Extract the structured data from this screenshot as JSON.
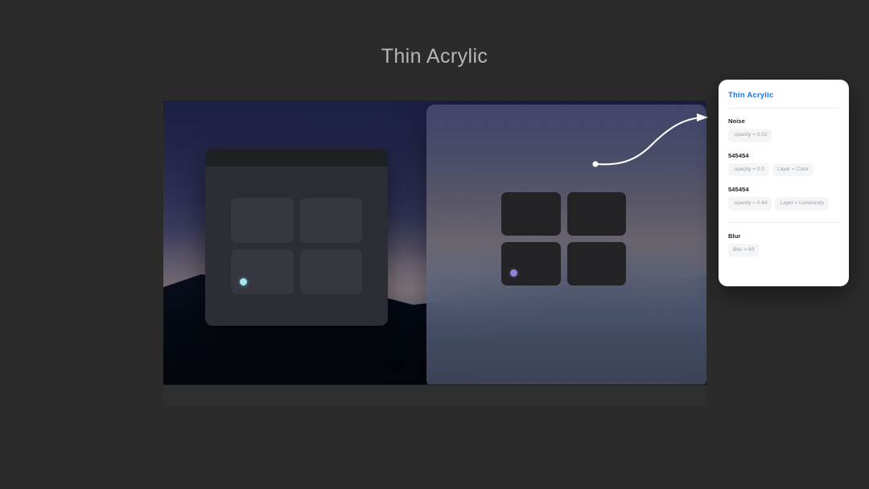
{
  "page": {
    "title": "Thin Acrylic",
    "background_color": "#2b2b2b",
    "title_color": "#b6b6b6"
  },
  "desktop": {
    "wallpaper_description": "night mountain landscape",
    "solid_window": {
      "name": "Opaque window sample",
      "dot_color": "#a6e3f2",
      "tile_color": "#35383f",
      "body_color": "#2b2e34",
      "titlebar_color": "#1f2023"
    },
    "acrylic_window": {
      "name": "Thin acrylic window sample",
      "dot_color": "#8b86d8",
      "tile_color": "#232326"
    }
  },
  "callout": {
    "arrow_color": "#ffffff"
  },
  "spec_card": {
    "title": "Thin Acrylic",
    "title_color": "#1a73e8",
    "groups": [
      {
        "label": "Noise",
        "chips": [
          ".opacity = 0.02"
        ]
      },
      {
        "label": "545454",
        "chips": [
          ".opacity = 0.0",
          "Layer = Color"
        ]
      },
      {
        "label": "545454",
        "chips": [
          ".opacity = 0.64",
          "Layer = Luminosity"
        ]
      },
      {
        "label": "Blur",
        "chips": [
          "Blur = 60"
        ]
      }
    ]
  }
}
